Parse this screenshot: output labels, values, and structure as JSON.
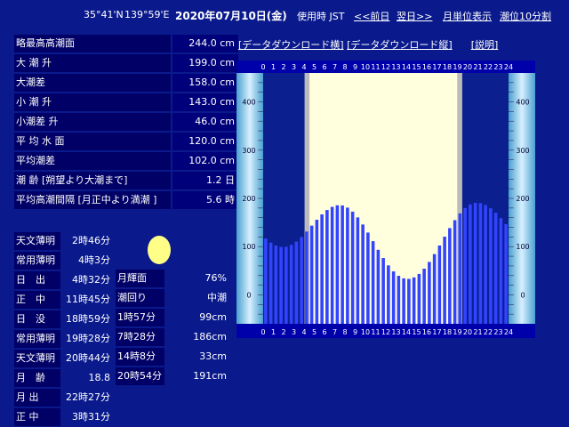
{
  "header": {
    "lat": "35°41'N",
    "lon": "139°59'E",
    "date": "2020年07月10日(金)",
    "timezone": "使用時 JST",
    "prev": "<<前日",
    "next": "翌日>>",
    "monthly": "月単位表示",
    "interval": "潮位10分割"
  },
  "links": {
    "download_h": "[データダウンロード横]",
    "download_v": "[データダウンロード縦]",
    "help": "[説明]"
  },
  "stats": [
    {
      "label": "略最高高潮面",
      "value": "244.0 cm"
    },
    {
      "label": "大 潮 升",
      "value": "199.0 cm"
    },
    {
      "label": "大潮差",
      "value": "158.0 cm"
    },
    {
      "label": "小 潮 升",
      "value": "143.0 cm"
    },
    {
      "label": "小潮差 升",
      "value": "46.0 cm"
    },
    {
      "label": "平 均 水 面",
      "value": "120.0 cm"
    },
    {
      "label": "平均潮差",
      "value": "102.0 cm"
    },
    {
      "label": "潮 齢 [朔望より大潮まで]",
      "value": "1.2 日"
    },
    {
      "label": "平均高潮間隔 [月正中より満潮 ]",
      "value": "5.6 時"
    }
  ],
  "daily": [
    {
      "label": "天文薄明",
      "value": "2時46分"
    },
    {
      "label": "常用薄明",
      "value": "4時3分"
    },
    {
      "label": "日　出",
      "value": "4時32分"
    },
    {
      "label": "正　中",
      "value": "11時45分"
    },
    {
      "label": "日　没",
      "value": "18時59分"
    },
    {
      "label": "常用薄明",
      "value": "19時28分"
    },
    {
      "label": "天文薄明",
      "value": "20時44分"
    },
    {
      "label": "月　齢",
      "value": "18.8"
    },
    {
      "label": "月 出",
      "value": "22時27分"
    },
    {
      "label": "正 中",
      "value": "3時31分"
    }
  ],
  "moon": [
    {
      "label": "月輝面",
      "value": "76%"
    },
    {
      "label": "潮回り",
      "value": "中潮"
    },
    {
      "label": "1時57分",
      "value": "99cm"
    },
    {
      "label": "7時28分",
      "value": "186cm"
    },
    {
      "label": "14時8分",
      "value": "33cm"
    },
    {
      "label": "20時54分",
      "value": "191cm"
    }
  ],
  "colors": {
    "background": "#0a1a8c",
    "bar": "#3344ff",
    "daylight": "#ffffdd",
    "twilight": "#bbbbbb",
    "night": "#0b1f8f",
    "moon": "#ffff88"
  },
  "chart_data": {
    "type": "bar",
    "x_ticks": [
      "0",
      "1",
      "2",
      "3",
      "4",
      "5",
      "6",
      "7",
      "8",
      "9",
      "10",
      "11",
      "12",
      "13",
      "14",
      "15",
      "16",
      "17",
      "18",
      "19",
      "20",
      "21",
      "22",
      "23",
      "24"
    ],
    "y_ticks": [
      "0",
      "100",
      "200",
      "300",
      "400"
    ],
    "ylim": [
      -60,
      460
    ],
    "xlim": [
      0,
      24
    ],
    "daylight": {
      "start_hour": 4.53,
      "end_hour": 18.98
    },
    "twilight": {
      "start_hour": 4.05,
      "end_hour": 19.47
    },
    "tides": [
      {
        "hour": 1.95,
        "height": 99
      },
      {
        "hour": 7.47,
        "height": 186
      },
      {
        "hour": 14.13,
        "height": 33
      },
      {
        "hour": 20.9,
        "height": 191
      }
    ],
    "bar_step_hours": 0.5
  }
}
